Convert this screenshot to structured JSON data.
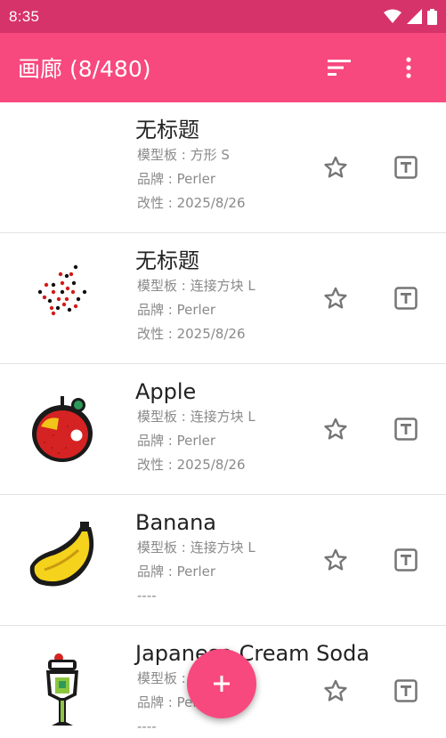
{
  "status_bar": {
    "time": "8:35",
    "icons": [
      "wifi-icon",
      "cell-signal-icon",
      "battery-icon"
    ]
  },
  "app_bar": {
    "title": "画廊 (8/480)",
    "sort_icon": "sort-icon",
    "more_icon": "more-vert-icon"
  },
  "items": [
    {
      "title": "无标题",
      "template": "模型板 : 方形 S",
      "brand": "品牌 : Perler",
      "modified": "改性 : 2025/8/26",
      "thumbnail": "blank"
    },
    {
      "title": "无标题",
      "template": "模型板 : 连接方块 L",
      "brand": "品牌 : Perler",
      "modified": "改性 : 2025/8/26",
      "thumbnail": "scatter"
    },
    {
      "title": "Apple",
      "template": "模型板 : 连接方块 L",
      "brand": "品牌 : Perler",
      "modified": "改性 : 2025/8/26",
      "thumbnail": "apple"
    },
    {
      "title": "Banana",
      "template": "模型板 : 连接方块 L",
      "brand": "品牌 : Perler",
      "modified": "----",
      "thumbnail": "banana"
    },
    {
      "title": "Japanese Cream Soda",
      "template": "模型板 : 连接方块 L",
      "brand": "品牌 : Perler",
      "modified": "----",
      "thumbnail": "soda"
    }
  ],
  "fab": {
    "icon": "plus-icon",
    "label": "+"
  },
  "colors": {
    "status_bar": "#d6336b",
    "app_bar": "#f7497e",
    "accent": "#f7497e"
  }
}
